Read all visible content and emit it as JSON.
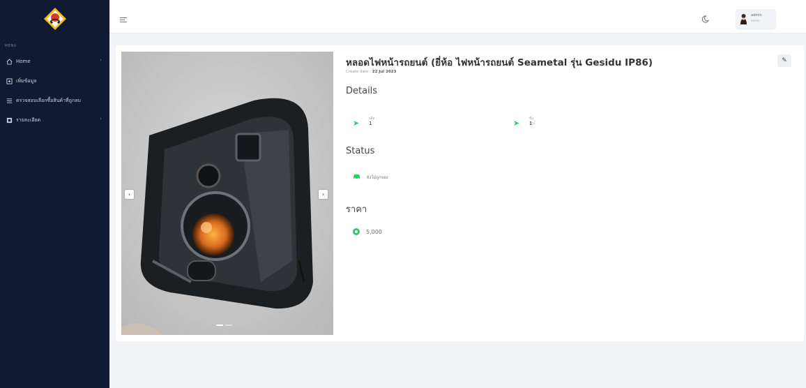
{
  "sidebar": {
    "menu_heading": "MENU",
    "items": [
      {
        "label": "Home",
        "icon": "home-icon",
        "has_children": true
      },
      {
        "label": "เพิ่มข้อมูล",
        "icon": "add-document-icon",
        "has_children": false
      },
      {
        "label": "ตรวจสอบเลือกซื้อสินค้าที่ถูกลบ",
        "icon": "list-icon",
        "has_children": false
      },
      {
        "label": "รายละเอียด",
        "icon": "box-icon",
        "has_children": true
      }
    ]
  },
  "header": {
    "user": {
      "name": "admin",
      "role": "admin"
    }
  },
  "product": {
    "title": "หลอดไฟหน้ารถยนต์ (ยี่ห้อ ไฟหน้ารถยนต์ Seametal รุ่น Gesidu IP86)",
    "create_date_label": "Create date :",
    "create_date": "22 Jul 2023",
    "details_heading": "Details",
    "details": [
      {
        "label": "ผลิต",
        "value": "1"
      },
      {
        "label": "ชิ้นงาน",
        "value": "1"
      }
    ],
    "status_heading": "Status",
    "status_text": "ยังไม่ถูกจอง",
    "price_heading": "ราคา",
    "price": "5,000",
    "carousel": {
      "slides": 2,
      "active": 1
    }
  },
  "colors": {
    "sidebar_bg": "#111a33",
    "accent": "#2ecc71",
    "logo_yellow": "#f2b81e"
  }
}
